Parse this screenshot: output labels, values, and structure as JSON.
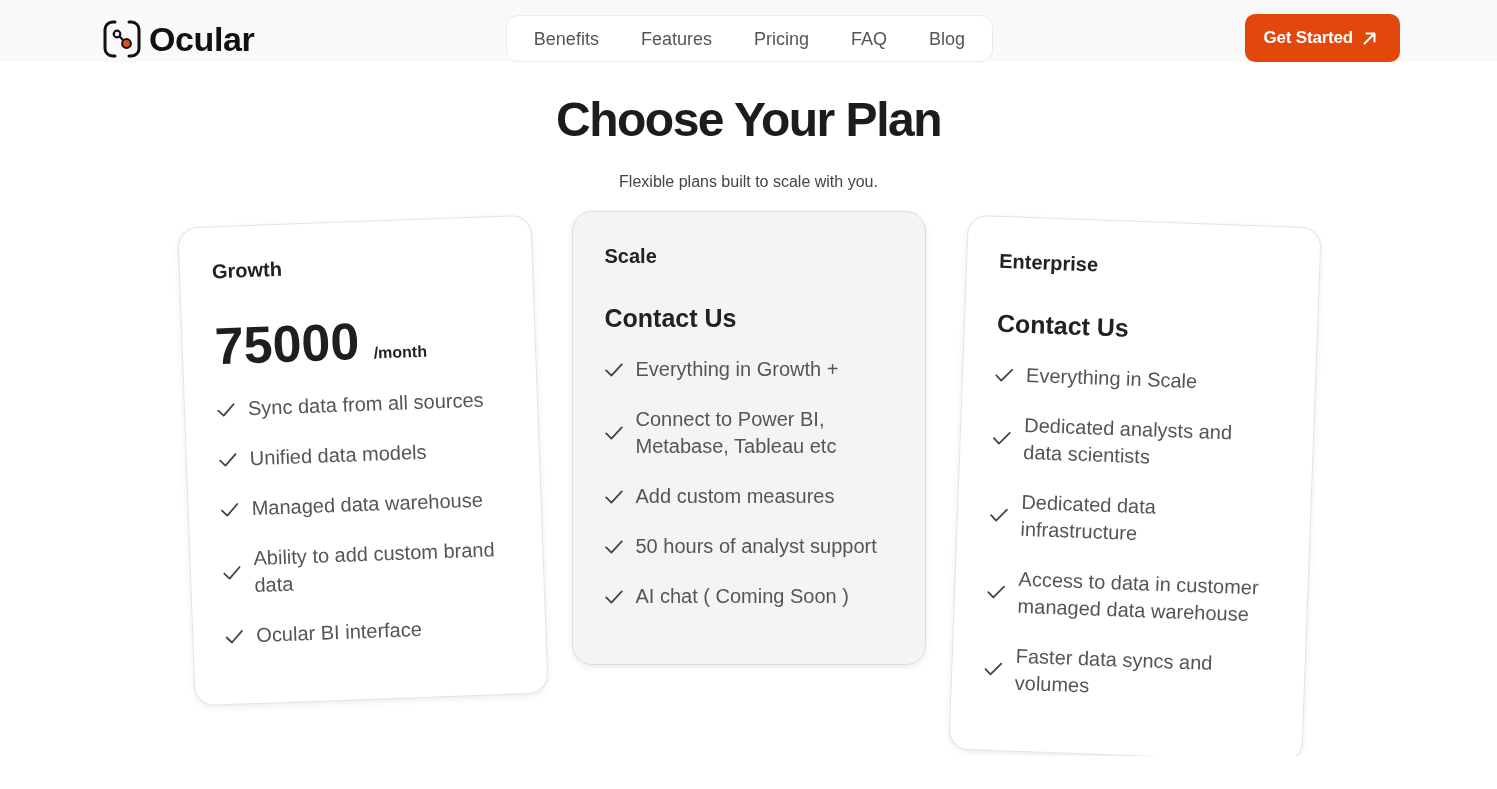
{
  "header": {
    "logo": {
      "name": "Ocular"
    },
    "nav": [
      {
        "label": "Benefits"
      },
      {
        "label": "Features"
      },
      {
        "label": "Pricing"
      },
      {
        "label": "FAQ"
      },
      {
        "label": "Blog"
      }
    ],
    "cta": {
      "label": "Get Started"
    }
  },
  "hero": {
    "title": "Choose Your Plan",
    "subtitle": "Flexible plans built to scale with you."
  },
  "plans": [
    {
      "name": "Growth",
      "highlighted": false,
      "price": {
        "kind": "amount",
        "value": "75000",
        "period": "/month"
      },
      "features": [
        "Sync data from all sources",
        "Unified data models",
        "Managed data warehouse",
        "Ability to add custom brand data",
        "Ocular BI interface"
      ]
    },
    {
      "name": "Scale",
      "highlighted": true,
      "price": {
        "kind": "contact",
        "value": "Contact Us"
      },
      "features": [
        "Everything in Growth +",
        "Connect to Power BI, Metabase, Tableau etc",
        "Add custom measures",
        "50 hours of analyst support",
        "AI chat ( Coming Soon )"
      ]
    },
    {
      "name": "Enterprise",
      "highlighted": false,
      "price": {
        "kind": "contact",
        "value": "Contact Us"
      },
      "features": [
        "Everything in Scale",
        "Dedicated analysts and data scientists",
        "Dedicated data infrastructure",
        "Access to data in customer managed data warehouse",
        "Faster data syncs and volumes"
      ]
    }
  ]
}
